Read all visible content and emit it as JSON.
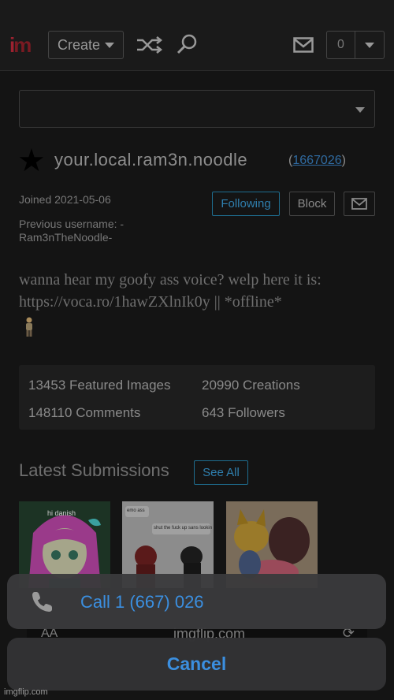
{
  "header": {
    "logo_i": "i",
    "logo_m": "m",
    "create_label": "Create",
    "notification_count": "0",
    "icons": [
      "shuffle-icon",
      "search-icon",
      "mail-icon"
    ]
  },
  "profile": {
    "username": "your.local.ram3n.noodle",
    "user_id_open": "(",
    "user_id": "1667026",
    "user_id_close": ")",
    "joined": "Joined 2021-05-06",
    "previous_username": "Previous username: -Ram3nTheNoodle-",
    "following_label": "Following",
    "block_label": "Block",
    "bio": "wanna hear my goofy ass voice? welp here it is: https://voca.ro/1hawZXlnIk0y || *offline*",
    "link_color": "#2f6aa0",
    "accent_color": "#2f7fae"
  },
  "stats": {
    "featured": "13453 Featured Images",
    "creations": "20990 Creations",
    "comments": "148110 Comments",
    "followers": "643 Followers"
  },
  "latest": {
    "title": "Latest Submissions",
    "see_all": "See All",
    "thumbs": [
      {
        "caption": "hi danish"
      },
      {
        "caption_top": "emo ass",
        "caption_mid": "shut the fuck up sans lookin"
      },
      {
        "caption": ""
      }
    ]
  },
  "browser": {
    "text_size": "AA",
    "url": "imgflip.com"
  },
  "action_sheet": {
    "call_label": "Call 1 (667) 026",
    "cancel_label": "Cancel",
    "action_color": "#3b8fe0"
  },
  "watermark": "imgflip.com"
}
